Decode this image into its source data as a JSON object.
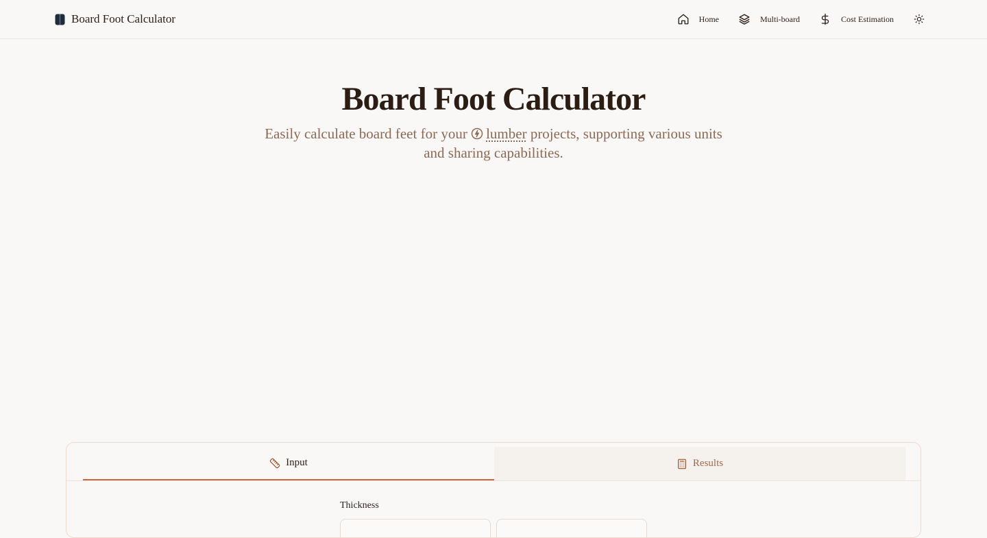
{
  "header": {
    "brand_title": "Board Foot Calculator",
    "nav": [
      {
        "label": "Home",
        "icon": "home-icon"
      },
      {
        "label": "Multi-board",
        "icon": "layers-icon"
      },
      {
        "label": "Cost Estimation",
        "icon": "dollar-icon"
      }
    ],
    "theme_toggle_icon": "sun-icon"
  },
  "hero": {
    "title": "Board Foot Calculator",
    "subtitle_before": "Easily calculate board feet for your",
    "link_text": "lumber",
    "subtitle_after": "projects, supporting various units and sharing capabilities."
  },
  "calculator": {
    "tabs": [
      {
        "label": "Input",
        "icon": "ruler-icon",
        "active": true
      },
      {
        "label": "Results",
        "icon": "calculator-icon",
        "active": false
      }
    ],
    "thickness_label": "Thickness"
  },
  "colors": {
    "accent": "#c9683a",
    "text": "#2b1d14",
    "muted": "#8b6a55",
    "background": "#faf8f6"
  }
}
